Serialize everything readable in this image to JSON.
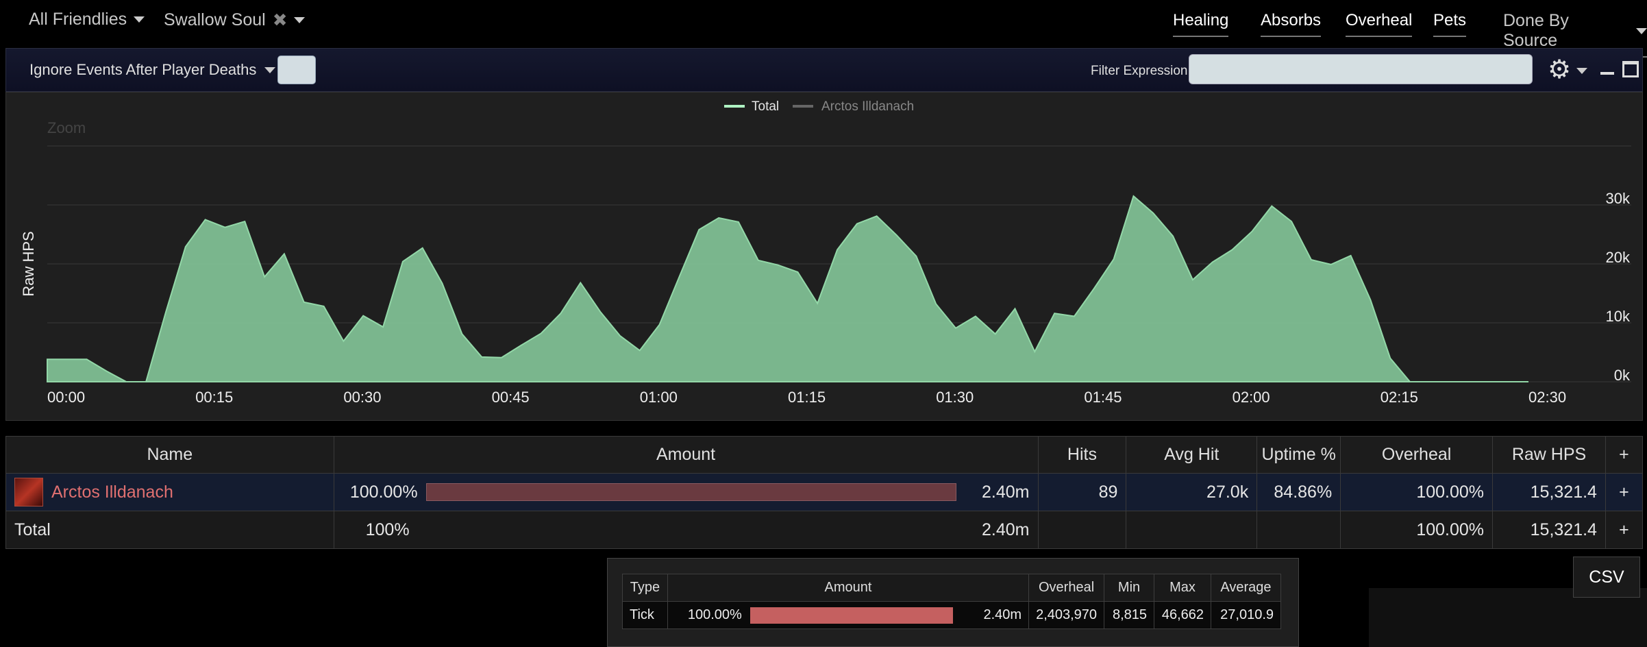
{
  "topbar": {
    "friendlies": "All Friendlies",
    "ability": "Swallow Soul",
    "tabs": [
      "Healing",
      "Absorbs",
      "Overheal",
      "Pets"
    ],
    "done_by": "Done By Source"
  },
  "filterbar": {
    "ignore": "Ignore Events After Player Deaths",
    "filter_label": "Filter Expression:",
    "filter_value": ""
  },
  "chart_data": {
    "type": "area",
    "legend": [
      "Total",
      "Arctos Illdanach"
    ],
    "zoom_label": "Zoom",
    "ylabel": "Raw HPS",
    "ylim": [
      0,
      40000
    ],
    "y_ticks": [
      "0k",
      "10k",
      "20k",
      "30k"
    ],
    "x_ticks": [
      "00:00",
      "00:15",
      "00:30",
      "00:45",
      "01:00",
      "01:15",
      "01:30",
      "01:45",
      "02:00",
      "02:15",
      "02:30"
    ],
    "x_seconds": [
      0,
      2,
      4,
      6,
      8,
      10,
      12,
      14,
      16,
      18,
      20,
      22,
      24,
      26,
      28,
      30,
      32,
      34,
      36,
      38,
      40,
      42,
      44,
      46,
      48,
      50,
      52,
      54,
      56,
      58,
      60,
      62,
      64,
      66,
      68,
      70,
      72,
      74,
      76,
      78,
      80,
      82,
      84,
      86,
      88,
      90,
      92,
      94,
      96,
      98,
      100,
      102,
      104,
      106,
      108,
      110,
      112,
      114,
      116,
      118,
      120,
      122,
      124,
      126,
      128,
      130,
      132,
      134,
      136,
      138,
      140,
      142,
      144,
      146,
      148,
      150
    ],
    "values": [
      3800,
      3800,
      3800,
      1800,
      0,
      0,
      11800,
      22900,
      27500,
      26200,
      27200,
      17800,
      21700,
      13500,
      12800,
      6900,
      11200,
      9300,
      20400,
      22700,
      16700,
      8100,
      4200,
      4100,
      6200,
      8200,
      11600,
      16800,
      11900,
      7800,
      5300,
      9700,
      17800,
      25800,
      27800,
      27100,
      20600,
      19800,
      18600,
      13300,
      22400,
      26800,
      28100,
      24900,
      21300,
      13200,
      9100,
      11100,
      8100,
      12400,
      5100,
      11600,
      11100,
      15800,
      20800,
      31500,
      28600,
      24700,
      17300,
      20300,
      22400,
      25500,
      29800,
      27200,
      20700,
      19900,
      21400,
      13900,
      4000,
      0,
      0,
      0,
      0,
      0,
      0,
      0
    ],
    "series": [
      {
        "name": "Total",
        "color": "#7fbf94"
      }
    ]
  },
  "table": {
    "headers": [
      "Name",
      "Amount",
      "Hits",
      "Avg Hit",
      "Uptime %",
      "Overheal",
      "Raw HPS",
      "+"
    ],
    "rows": [
      {
        "name": "Arctos Illdanach",
        "pct": "100.00%",
        "amount": "2.40m",
        "hits": "89",
        "avg_hit": "27.0k",
        "uptime": "84.86%",
        "overheal": "100.00%",
        "raw_hps": "15,321.4",
        "plus": "+",
        "bar_fraction": 1.0
      }
    ],
    "total": {
      "name": "Total",
      "pct": "100%",
      "amount": "2.40m",
      "overheal": "100.00%",
      "raw_hps": "15,321.4",
      "plus": "+"
    }
  },
  "breakdown": {
    "headers": [
      "Type",
      "Amount",
      "Overheal",
      "Min",
      "Max",
      "Average"
    ],
    "row": {
      "type": "Tick",
      "pct": "100.00%",
      "amount": "2.40m",
      "overheal": "2,403,970",
      "min": "8,815",
      "max": "46,662",
      "average": "27,010.9",
      "bar_fraction": 1.0
    }
  },
  "csv": "CSV",
  "colors": {
    "accent_green": "#7fbf94",
    "bar_red": "#c56060",
    "name_red": "#e07070"
  }
}
